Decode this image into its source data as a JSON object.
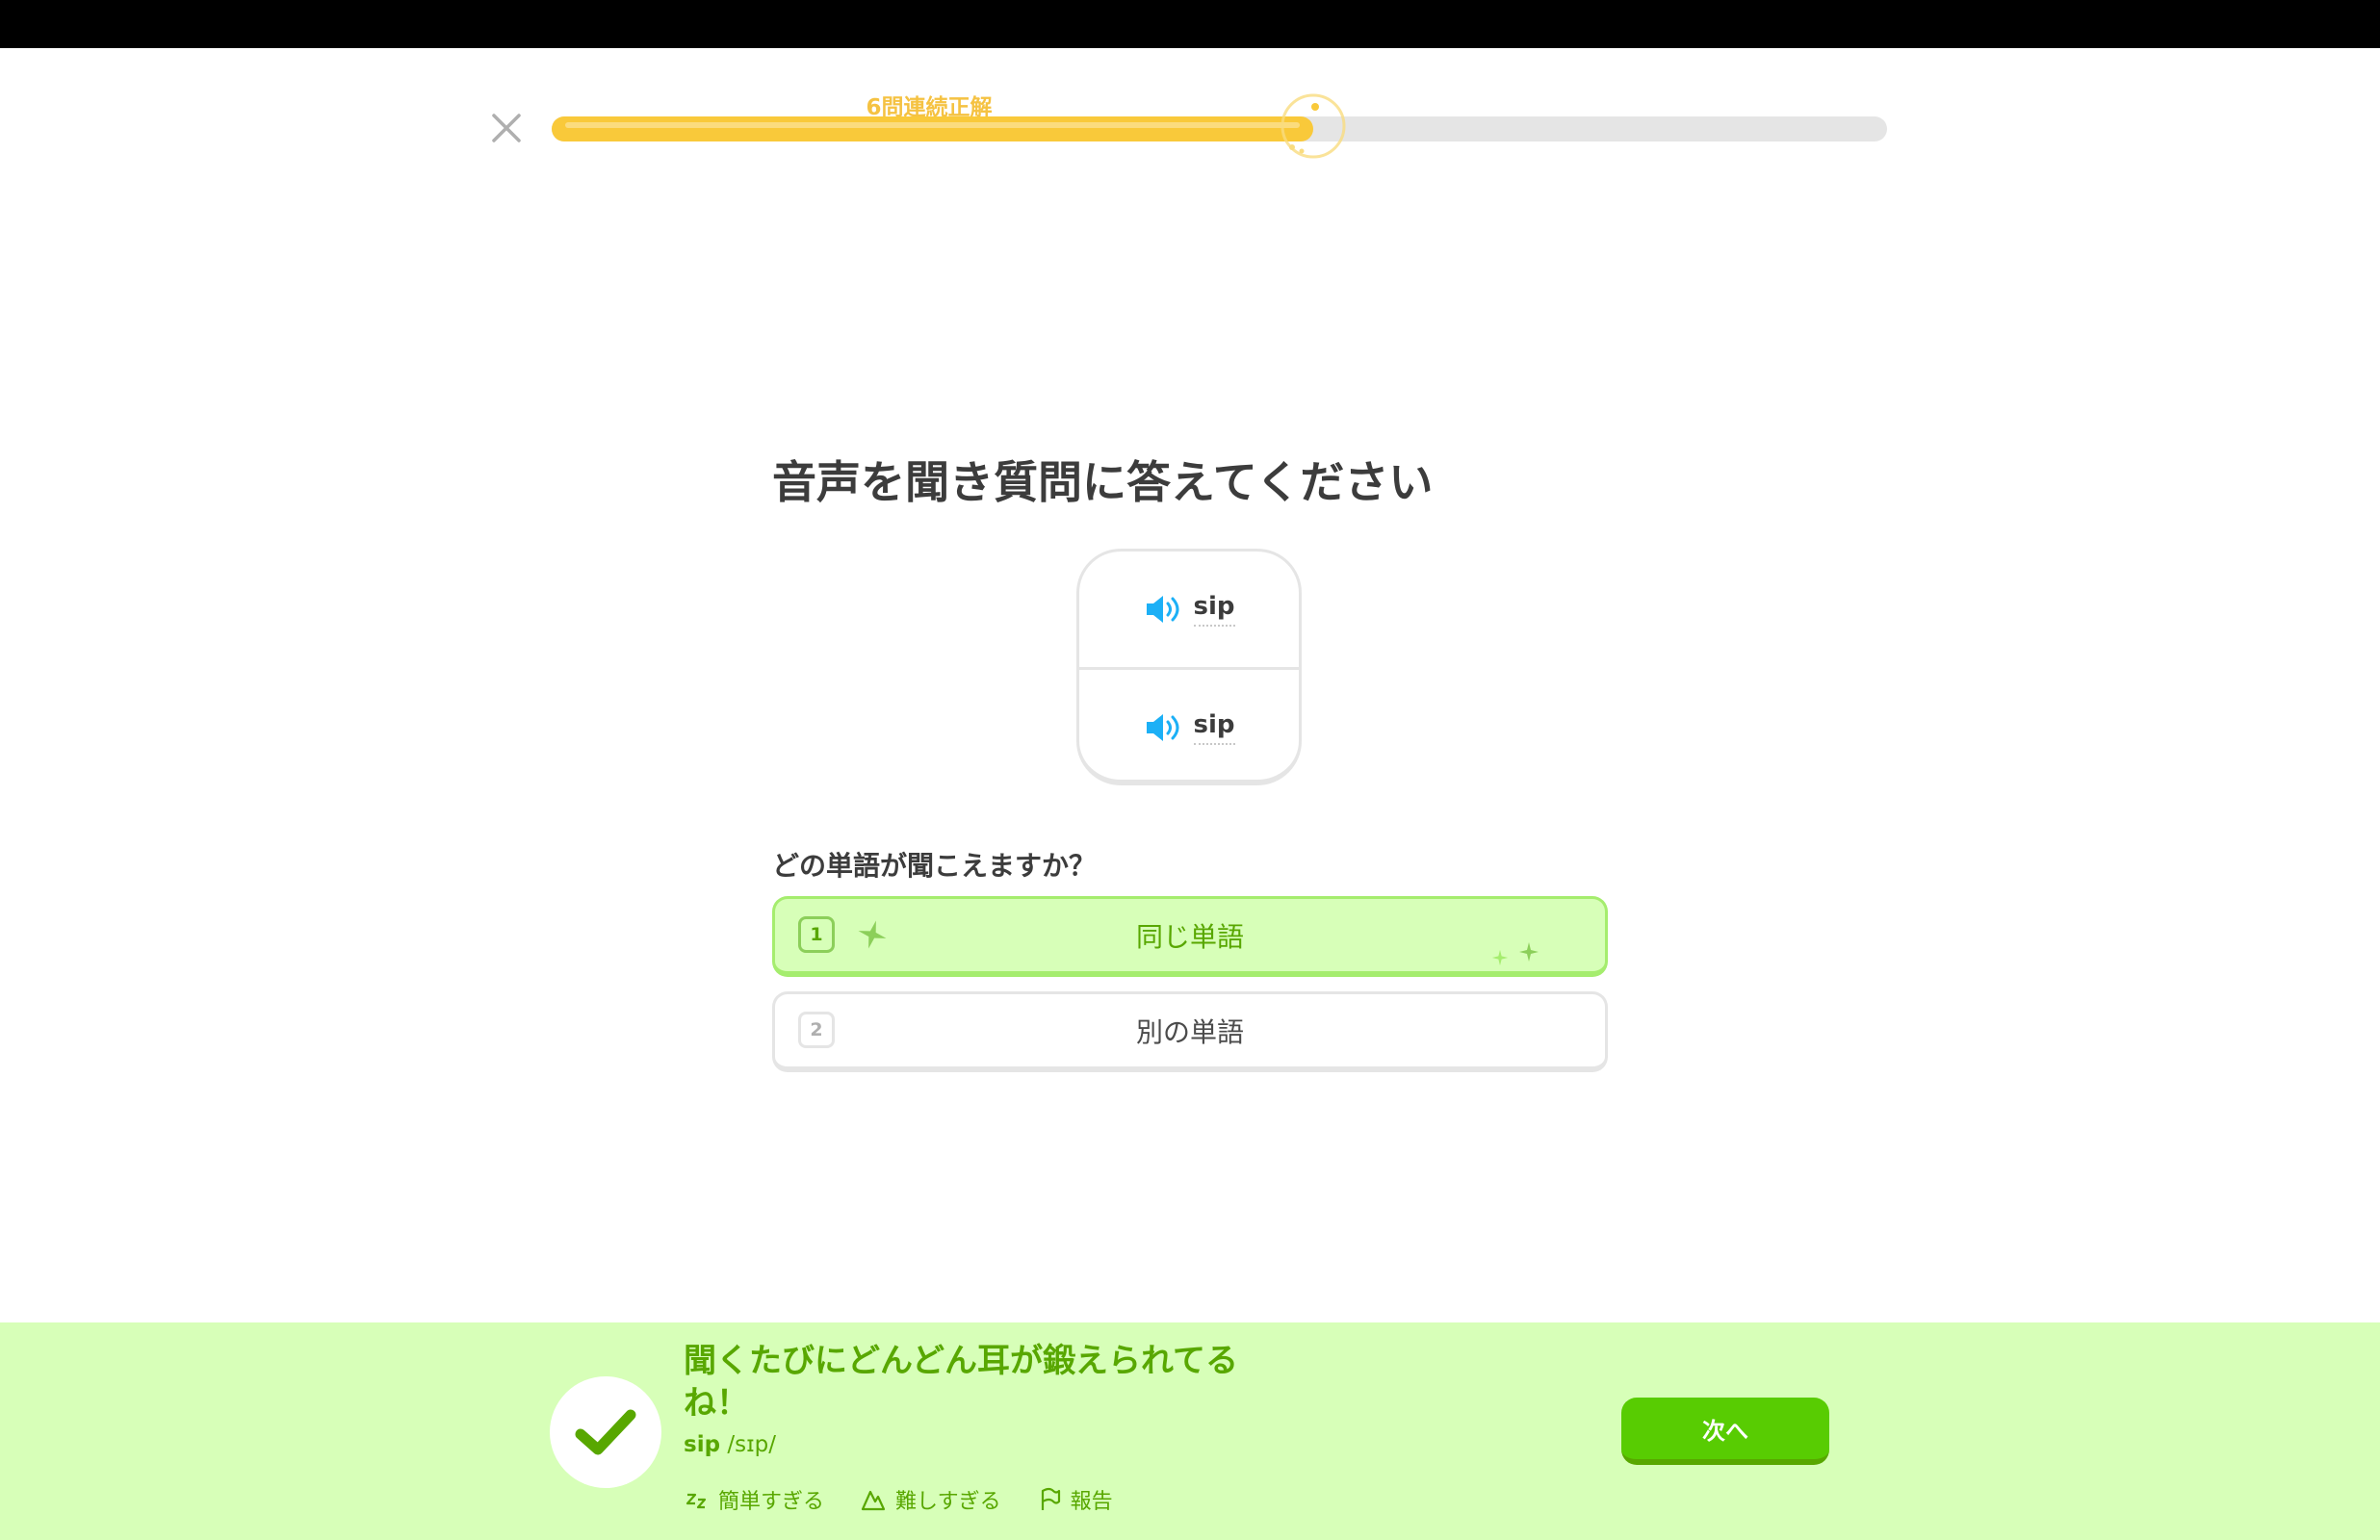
{
  "header": {
    "streak_label": "6問連続正解",
    "progress_fraction": 0.57
  },
  "question": {
    "title": "音声を聞き質問に答えてください",
    "audio_items": [
      {
        "word": "sip",
        "icon": "speaker-icon"
      },
      {
        "word": "sip",
        "icon": "speaker-icon"
      }
    ],
    "prompt": "どの単語が聞こえますか？"
  },
  "choices": [
    {
      "number": "1",
      "label": "同じ単語",
      "state": "selected-correct"
    },
    {
      "number": "2",
      "label": "別の単語",
      "state": "default"
    }
  ],
  "feedback": {
    "message": "聞くたびにどんどん耳が鍛えられてるね！",
    "answer_word": "sip",
    "answer_ipa": "/sɪp/",
    "actions": [
      {
        "label": "簡単すぎる",
        "icon": "zzz-icon"
      },
      {
        "label": "難しすぎる",
        "icon": "mountain-icon"
      },
      {
        "label": "報告",
        "icon": "flag-icon"
      }
    ],
    "next_label": "次へ"
  },
  "colors": {
    "progress": "#f9c93a",
    "correct_bg": "#d7ffb8",
    "correct_text": "#58a700",
    "button_green": "#58cc02",
    "speaker_blue": "#1cb0f6"
  }
}
